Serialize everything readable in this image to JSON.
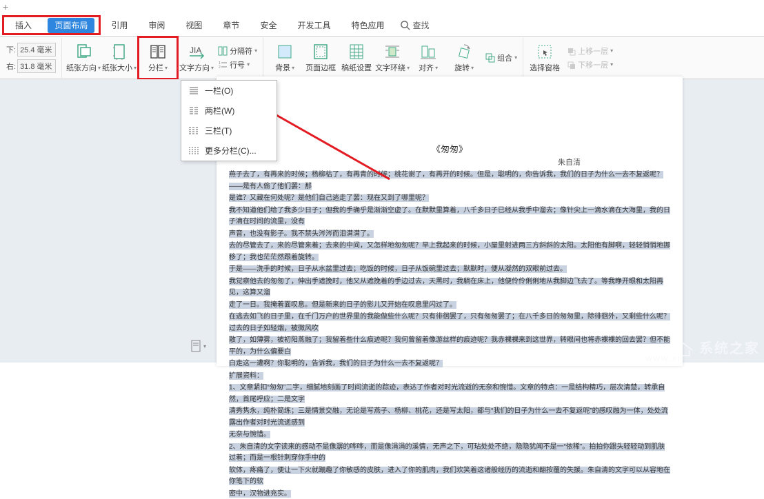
{
  "topbar": {
    "insert_label": "插入"
  },
  "tabs": {
    "page_layout": "页面布局",
    "references": "引用",
    "review": "审阅",
    "view": "视图",
    "sections": "章节",
    "security": "安全",
    "dev_tools": "开发工具",
    "featured": "特色应用",
    "search": "查找"
  },
  "margins": {
    "top_label": "下:",
    "top_value": "25.4 毫米",
    "right_label": "右:",
    "right_value": "31.8 毫米"
  },
  "ribbon": {
    "orientation": "纸张方向",
    "size": "纸张大小",
    "columns": "分栏",
    "text_direction": "文字方向",
    "breaks": "分隔符",
    "line_numbers": "行号",
    "background": "背景",
    "page_border": "页面边框",
    "grid_settings": "稿纸设置",
    "text_wrap": "文字环绕",
    "align": "对齐",
    "rotate": "旋转",
    "group": "组合",
    "selection_pane": "选择窗格",
    "bring_forward": "上移一层",
    "send_backward": "下移一层"
  },
  "columns_dropdown": {
    "one": "一栏(O)",
    "two": "两栏(W)",
    "three": "三栏(T)",
    "more": "更多分栏(C)..."
  },
  "document": {
    "title": "《匆匆》",
    "author": "朱自清",
    "p1": "燕子去了，有再来的时候；杨柳枯了，有再青的时候；桃花谢了，有再开的时候。但是，聪明的，你告诉我，我们的日子为什么一去不复返呢？——是有人偷了他们罢：那",
    "p1b": "是谁？又藏在何处呢？是他们自己逃走了罢：现在又到了哪里呢？",
    "p2": "我不知道他们给了我多少日子；但我的手确乎是渐渐空虚了。在默默里算着，八千多日子已经从我手中溜去；像针尖上一滴水滴在大海里，我的日子滴在时间的流里，没有",
    "p2b": "声音，也没有影子。我不禁头涔涔而泪潸潸了。",
    "p3": "去的尽管去了，来的尽管来着；去来的中间，又怎样地匆匆呢？早上我起来的时候，小屋里射进两三方斜斜的太阳。太阳他有脚啊，轻轻悄悄地挪移了；我也茫茫然跟着旋转。",
    "p3b": "于是——洗手的时候，日子从水盆里过去；吃饭的时候，日子从饭碗里过去；默默时，便从凝然的双眼前过去。",
    "p4": "我觉察他去的匆匆了，伸出手遮挽时，他又从遮挽着的手边过去，天黑时，我躺在床上，他便伶伶俐俐地从我脚边飞去了。等我睁开眼和太阳再见，这算又溜",
    "p4b": "走了一日。我掩着面叹息。但是新来的日子的影儿又开始在叹息里闪过了。",
    "p5": "在逃去如飞的日子里，在千门万户的世界里的我能做些什么呢？只有徘徊罢了，只有匆匆罢了；在八千多日的匆匆里，除徘徊外，又剩些什么呢？过去的日子如轻烟，被微风吹",
    "p5b": "散了，如薄雾，被初阳蒸融了；我留着些什么痕迹呢？我何曾留着像游丝样的痕迹呢？我赤裸裸来到这世界，转眼间也将赤裸裸的回去罢？但不能平的，为什么偏要白",
    "p5c": "白走这一遭啊？你聪明的，告诉我，我们的日子为什么一去不复返呢？",
    "p6": "扩展资料：",
    "p7": "1、文章紧扣“匆匆”二字，细腻地刻画了时间流逝的踪迹，表达了作者对时光流逝的无奈和惋惜。文章的特点：一是结构精巧，层次清楚，转承自然，首尾呼应；二是文字",
    "p7b": "清秀隽永，纯朴简练；三是情景交融，无论是写燕子、杨柳、桃花，还是写太阳，都与“我们的日子为什么一去不复返呢”的感叹融为一体，处处流露出作者对时光流逝感到",
    "p7c": "无奈与惋惜。",
    "p8": "2、朱自清的文字读来的感动不是像潺的哗哗，而是像涓涓的溪情，无声之下，可玷处处不绝，隐隐犹闻不是一“依稀”。拍拍你跟头轻轻动到肌肤过着；而是一根针刺穿你手中的",
    "p8b": "软体，疼痛了，便让一下火就蹦趣了你敏感的皮肤，进入了你的肌肉，我们欢笑着这诸般经历的流逝和翻按覆的失援。朱自清的文字可以从容地在你笔下的软",
    "p8c": "密中，汉物进充实。",
    "link1": "徘徊",
    "link2": "影儿"
  },
  "watermark": {
    "brand": "系统之家",
    "url": "WWW.XITONGZHIJIA.NET"
  }
}
